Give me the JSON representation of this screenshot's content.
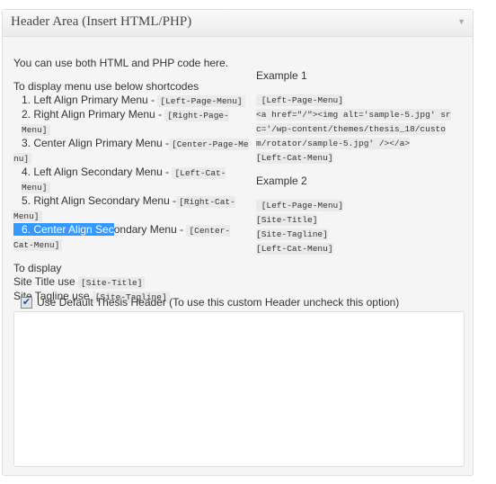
{
  "panel": {
    "title": "Header Area (Insert HTML/PHP)",
    "toggle_icon": "triangle-down"
  },
  "left": {
    "intro": "You can use both HTML and PHP code here.",
    "menu_heading": "To display menu use below shortcodes",
    "items": [
      {
        "label": "1. Left Align Primary Menu - ",
        "code": "[Left-Page-Menu]"
      },
      {
        "label": "2. Right Align Primary Menu - ",
        "code": "[Right-Page-Menu]"
      },
      {
        "label": "3. Center Align Primary Menu - ",
        "code": "[Center-Page-Menu]"
      },
      {
        "label": "4. Left Align Secondary Menu - ",
        "code": "[Left-Cat-Menu]"
      },
      {
        "label": "5. Right Align Secondary Menu - ",
        "code": "[Right-Cat-Menu]"
      },
      {
        "label_selected": "6. Center Align Sec",
        "label": "ondary Menu - ",
        "code": "[Center-Cat-Menu]"
      }
    ],
    "display_heading": "To display",
    "site_title_label": "Site Title use ",
    "site_title_code": "[Site-Title]",
    "site_tagline_label": "Site Tagline use ",
    "site_tagline_code": "[Site-Tagline]"
  },
  "right": {
    "example1_title": "Example 1",
    "example1_code": " [Left-Page-Menu]\n<a href=\"/\"><img alt='sample-5.jpg' src='/wp-content/themes/thesis_18/custom/rotator/sample-5.jpg' /></a>\n[Left-Cat-Menu]",
    "example2_title": "Example 2",
    "example2_code": " [Left-Page-Menu]\n[Site-Title]\n[Site-Tagline]\n[Left-Cat-Menu]"
  },
  "checkbox": {
    "label": "Use Default Thesis Header (To use this custom Header uncheck this option)",
    "checked": true
  },
  "textarea": {
    "value": ""
  }
}
